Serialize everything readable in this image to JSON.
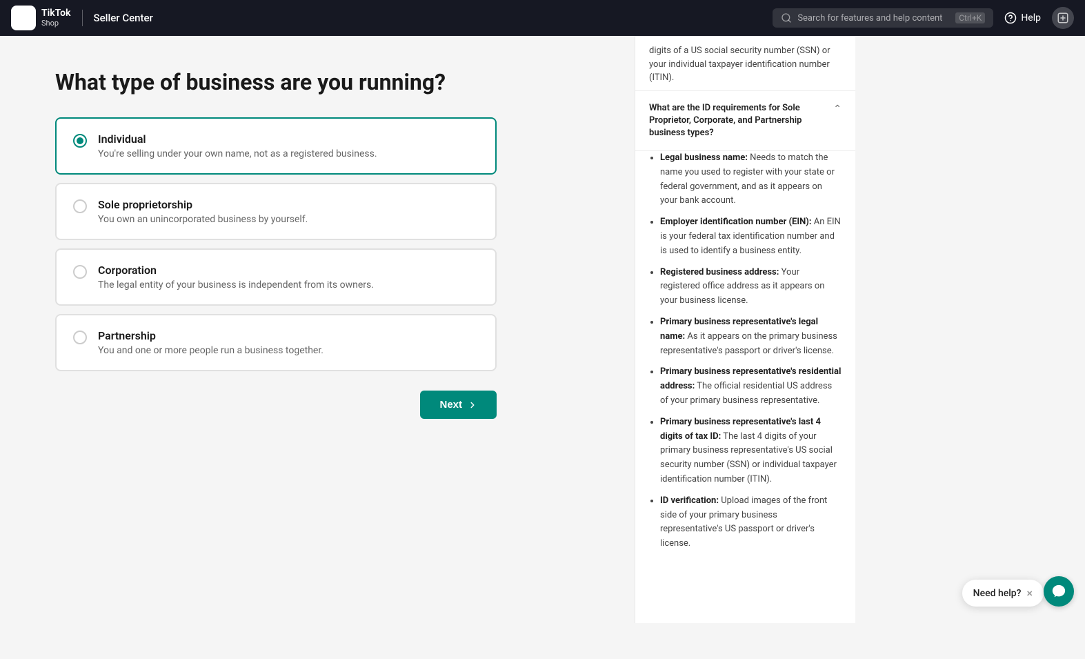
{
  "header": {
    "logo_tiktok": "TikTok",
    "logo_shop": "Shop",
    "seller_center": "Seller Center",
    "search_placeholder": "Search for features and help content",
    "search_shortcut": "Ctrl+K",
    "help_label": "Help"
  },
  "page": {
    "title": "What type of business are you running?",
    "options": [
      {
        "id": "individual",
        "label": "Individual",
        "description": "You're selling under your own name, not as a registered business.",
        "selected": true
      },
      {
        "id": "sole_proprietorship",
        "label": "Sole proprietorship",
        "description": "You own an unincorporated business by yourself.",
        "selected": false
      },
      {
        "id": "corporation",
        "label": "Corporation",
        "description": "The legal entity of your business is independent from its owners.",
        "selected": false
      },
      {
        "id": "partnership",
        "label": "Partnership",
        "description": "You and one or more people run a business together.",
        "selected": false
      }
    ],
    "next_button": "Next"
  },
  "right_panel": {
    "top_text": "digits of a US social security number (SSN) or your individual taxpayer identification number (ITIN).",
    "faq": {
      "question": "What are the ID requirements for Sole Proprietor, Corporate, and Partnership business types?",
      "expanded": true,
      "items": [
        {
          "term": "Legal business name:",
          "detail": "Needs to match the name you used to register with your state or federal government, and as it appears on your bank account."
        },
        {
          "term": "Employer identification number (EIN):",
          "detail": "An EIN is your federal tax identification number and is used to identify a business entity."
        },
        {
          "term": "Registered business address:",
          "detail": "Your registered office address as it appears on your business license."
        },
        {
          "term": "Primary business representative's legal name:",
          "detail": "As it appears on the primary business representative's passport or driver's license."
        },
        {
          "term": "Primary business representative's residential address:",
          "detail": "The official residential US address of your primary business representative."
        },
        {
          "term": "Primary business representative's last 4 digits of tax ID:",
          "detail": "The last 4 digits of your primary business representative's US social security number (SSN) or individual taxpayer identification number (ITIN)."
        },
        {
          "term": "ID verification:",
          "detail": "Upload images of the front side of your primary business representative's US passport or driver's license."
        }
      ]
    }
  },
  "need_help": {
    "label": "Need help?",
    "close": "×"
  }
}
